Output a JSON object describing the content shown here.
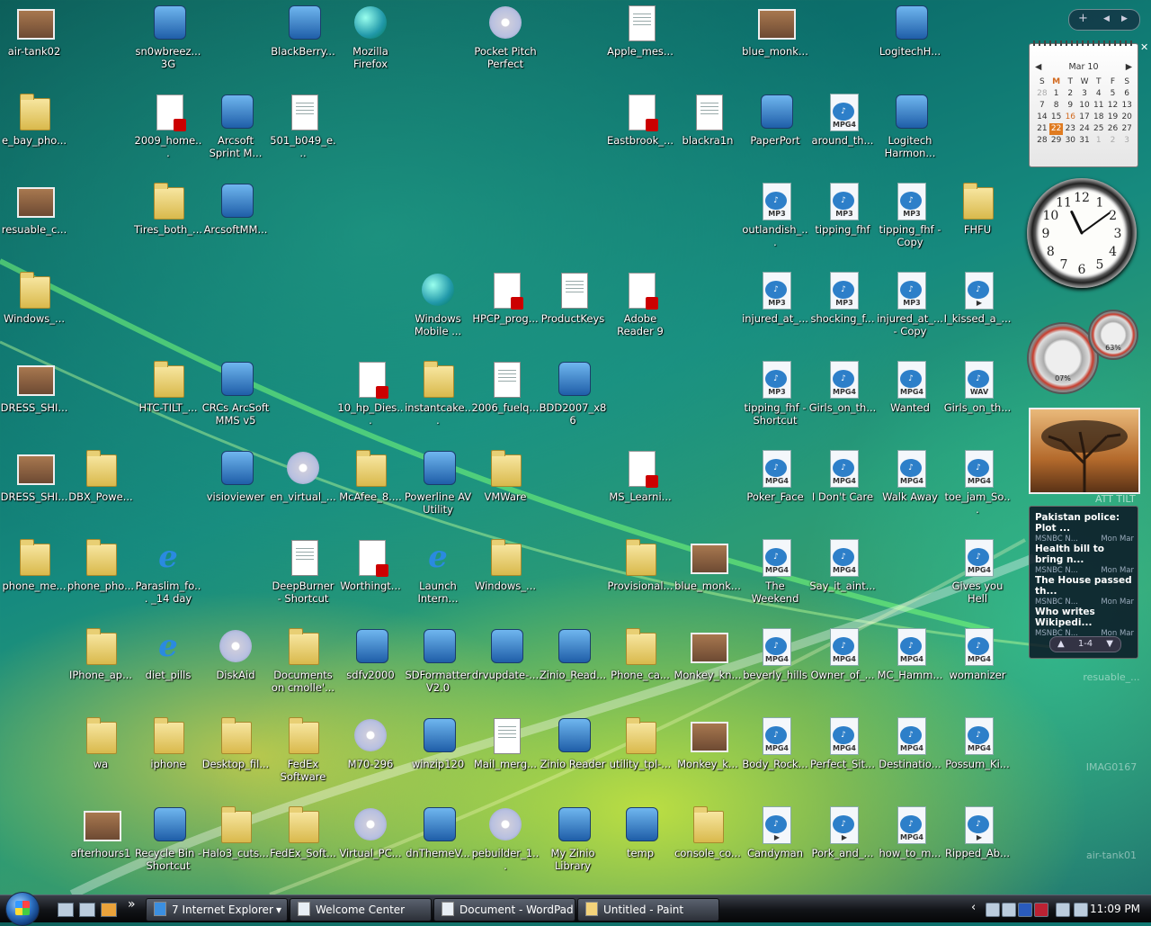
{
  "desktop_icons": [
    {
      "label": "air-tank02",
      "type": "photo",
      "col": 0,
      "row": 0
    },
    {
      "label": "sn0wbreez... 3G",
      "type": "app",
      "col": 1,
      "row": 0
    },
    {
      "label": "BlackBerry...",
      "type": "app",
      "col": 2,
      "row": 0
    },
    {
      "label": "Mozilla Firefox",
      "type": "globe",
      "col": 3,
      "row": 0
    },
    {
      "label": "Pocket Pitch Perfect",
      "type": "disc",
      "col": 4,
      "row": 0
    },
    {
      "label": "Apple_mes...",
      "type": "doc",
      "col": 5,
      "row": 0
    },
    {
      "label": "blue_monk...",
      "type": "photo",
      "col": 6,
      "row": 0
    },
    {
      "label": "LogitechH...",
      "type": "app",
      "col": 7,
      "row": 0
    },
    {
      "label": "e_bay_pho...",
      "type": "folder",
      "col": 0,
      "row": 1
    },
    {
      "label": "2009_home...",
      "type": "pdf",
      "col": 1,
      "row": 1
    },
    {
      "label": "Arcsoft Sprint M...",
      "type": "app",
      "col": 2,
      "row": 1
    },
    {
      "label": "501_b049_e...",
      "type": "doc",
      "col": 3,
      "row": 1
    },
    {
      "label": "Eastbrook_...",
      "type": "pdf",
      "col": 5,
      "row": 1
    },
    {
      "label": "blackra1n",
      "type": "doc",
      "col": 6,
      "row": 1
    },
    {
      "label": "PaperPort",
      "type": "app",
      "col": 7,
      "row": 1
    },
    {
      "label": "around_th...",
      "type": "media",
      "badge": "MPG4",
      "col": 8,
      "row": 1
    },
    {
      "label": "Logitech Harmon...",
      "type": "app",
      "col": 9,
      "row": 1
    },
    {
      "label": "resuable_c...",
      "type": "photo",
      "col": 0,
      "row": 2
    },
    {
      "label": "Tires_both_...",
      "type": "folder",
      "col": 1,
      "row": 2
    },
    {
      "label": "ArcsoftMM...",
      "type": "app",
      "col": 2,
      "row": 2
    },
    {
      "label": "outlandish_...",
      "type": "media",
      "badge": "MP3",
      "col": 7,
      "row": 2
    },
    {
      "label": "tipping_fhf",
      "type": "media",
      "badge": "MP3",
      "col": 8,
      "row": 2
    },
    {
      "label": "tipping_fhf - Copy",
      "type": "media",
      "badge": "MP3",
      "col": 9,
      "row": 2
    },
    {
      "label": "FHFU",
      "type": "folder",
      "col": 10,
      "row": 2
    },
    {
      "label": "Windows_...",
      "type": "folder",
      "col": 0,
      "row": 3
    },
    {
      "label": "Windows Mobile ...",
      "type": "globe",
      "col": 4,
      "row": 3
    },
    {
      "label": "HPCP_prog...",
      "type": "pdf",
      "col": 5,
      "row": 3
    },
    {
      "label": "ProductKeys",
      "type": "doc",
      "col": 6,
      "row": 3
    },
    {
      "label": "Adobe Reader 9",
      "type": "pdf",
      "col": 7,
      "row": 3
    },
    {
      "label": "injured_at_...",
      "type": "media",
      "badge": "MP3",
      "col": 8,
      "row": 3
    },
    {
      "label": "shocking_f...",
      "type": "media",
      "badge": "MP3",
      "col": 9,
      "row": 3
    },
    {
      "label": "injured_at_... - Copy",
      "type": "media",
      "badge": "MP3",
      "col": 10,
      "row": 3
    },
    {
      "label": "I_kissed_a_...",
      "type": "media",
      "badge": "▶",
      "col": 11,
      "row": 3
    },
    {
      "label": "DRESS_SHI...",
      "type": "photo",
      "col": 0,
      "row": 4
    },
    {
      "label": "HTC-TILT_...",
      "type": "folder",
      "col": 2,
      "row": 4
    },
    {
      "label": "CRCs ArcSoft MMS v5",
      "type": "app",
      "col": 3,
      "row": 4
    },
    {
      "label": "10_hp_Dies...",
      "type": "pdf",
      "col": 5,
      "row": 4
    },
    {
      "label": "instantcake...",
      "type": "folder",
      "col": 6,
      "row": 4
    },
    {
      "label": "2006_fuelq...",
      "type": "doc",
      "col": 7,
      "row": 4
    },
    {
      "label": "BDD2007_x86",
      "type": "app",
      "col": 8,
      "row": 4
    },
    {
      "label": "tipping_fhf - Shortcut",
      "type": "media",
      "badge": "MP3",
      "col": 9,
      "row": 4
    },
    {
      "label": "Girls_on_th...",
      "type": "media",
      "badge": "MPG4",
      "col": 10,
      "row": 4
    },
    {
      "label": "Wanted",
      "type": "media",
      "badge": "MPG4",
      "col": 11,
      "row": 4
    },
    {
      "label": "Girls_on_th...",
      "type": "media",
      "badge": "WAV",
      "col": 12,
      "row": 4
    },
    {
      "label": "DRESS_SHI...",
      "type": "photo",
      "col": 0,
      "row": 5
    },
    {
      "label": "DBX_Powe...",
      "type": "folder",
      "col": 1,
      "row": 5
    },
    {
      "label": "visioviewer",
      "type": "app",
      "col": 3,
      "row": 5
    },
    {
      "label": "en_virtual_...",
      "type": "disc",
      "col": 4,
      "row": 5
    },
    {
      "label": "McAfee_8....",
      "type": "folder",
      "col": 5,
      "row": 5
    },
    {
      "label": "Powerline AV Utility",
      "type": "app",
      "col": 6,
      "row": 5
    },
    {
      "label": "VMWare",
      "type": "folder",
      "col": 7,
      "row": 5
    },
    {
      "label": "MS_Learni...",
      "type": "pdf",
      "col": 9,
      "row": 5
    },
    {
      "label": "Poker_Face",
      "type": "media",
      "badge": "MPG4",
      "col": 11,
      "row": 5
    },
    {
      "label": "I Don't Care",
      "type": "media",
      "badge": "MPG4",
      "col": 12,
      "row": 5
    },
    {
      "label": "Walk Away",
      "type": "media",
      "badge": "MPG4",
      "col": 13,
      "row": 5
    },
    {
      "label": "toe_jam_So...",
      "type": "media",
      "badge": "MPG4",
      "col": 14,
      "row": 5
    },
    {
      "label": "phone_me...",
      "type": "folder",
      "col": 0,
      "row": 6
    },
    {
      "label": "phone_pho...",
      "type": "folder",
      "col": 1,
      "row": 6
    },
    {
      "label": "Paraslim_fo... _14 day",
      "type": "ie",
      "col": 2,
      "row": 6
    },
    {
      "label": "DeepBurner - Shortcut",
      "type": "doc",
      "col": 4,
      "row": 6
    },
    {
      "label": "Worthingt...",
      "type": "pdf",
      "col": 5,
      "row": 6
    },
    {
      "label": "Launch Intern...",
      "type": "ie",
      "col": 6,
      "row": 6
    },
    {
      "label": "Windows_...",
      "type": "folder",
      "col": 7,
      "row": 6
    },
    {
      "label": "Provisional...",
      "type": "folder",
      "col": 9,
      "row": 6
    },
    {
      "label": "blue_monk...",
      "type": "photo",
      "col": 10,
      "row": 6
    },
    {
      "label": "The Weekend",
      "type": "media",
      "badge": "MPG4",
      "col": 11,
      "row": 6
    },
    {
      "label": "Say_it_aint...",
      "type": "media",
      "badge": "MPG4",
      "col": 12,
      "row": 6
    },
    {
      "label": "Gives you Hell",
      "type": "media",
      "badge": "MPG4",
      "col": 14,
      "row": 6
    },
    {
      "label": "IPhone_ap...",
      "type": "folder",
      "col": 1,
      "row": 7
    },
    {
      "label": "diet_pills",
      "type": "ie",
      "col": 2,
      "row": 7
    },
    {
      "label": "DiskAid",
      "type": "disc",
      "col": 3,
      "row": 7
    },
    {
      "label": "Documents on cmolle'...",
      "type": "folder",
      "col": 4,
      "row": 7
    },
    {
      "label": "sdfv2000",
      "type": "app",
      "col": 5,
      "row": 7
    },
    {
      "label": "SDFormatter V2.0",
      "type": "app",
      "col": 6,
      "row": 7
    },
    {
      "label": "drvupdate-...",
      "type": "app",
      "col": 7,
      "row": 7
    },
    {
      "label": "Zinio_Read...",
      "type": "app",
      "col": 8,
      "row": 7
    },
    {
      "label": "Phone_ca...",
      "type": "folder",
      "col": 9,
      "row": 7
    },
    {
      "label": "Monkey_kn...",
      "type": "photo",
      "col": 10,
      "row": 7
    },
    {
      "label": "beverly_hills",
      "type": "media",
      "badge": "MPG4",
      "col": 11,
      "row": 7
    },
    {
      "label": "Owner_of_...",
      "type": "media",
      "badge": "MPG4",
      "col": 12,
      "row": 7
    },
    {
      "label": "MC_Hamm...",
      "type": "media",
      "badge": "MPG4",
      "col": 13,
      "row": 7
    },
    {
      "label": "womanizer",
      "type": "media",
      "badge": "MPG4",
      "col": 14,
      "row": 7
    },
    {
      "label": "wa",
      "type": "folder",
      "col": 1,
      "row": 8
    },
    {
      "label": "iphone",
      "type": "folder",
      "col": 2,
      "row": 8
    },
    {
      "label": "Desktop_fil...",
      "type": "folder",
      "col": 3,
      "row": 8
    },
    {
      "label": "FedEx Software",
      "type": "folder",
      "col": 4,
      "row": 8
    },
    {
      "label": "M70-296",
      "type": "disc",
      "col": 5,
      "row": 8
    },
    {
      "label": "winzip120",
      "type": "app",
      "col": 6,
      "row": 8
    },
    {
      "label": "Mail_merg...",
      "type": "doc",
      "col": 7,
      "row": 8
    },
    {
      "label": "Zinio Reader",
      "type": "app",
      "col": 8,
      "row": 8
    },
    {
      "label": "utility_tpl-...",
      "type": "folder",
      "col": 9,
      "row": 8
    },
    {
      "label": "Monkey_k...",
      "type": "photo",
      "col": 10,
      "row": 8
    },
    {
      "label": "Body_Rock...",
      "type": "media",
      "badge": "MPG4",
      "col": 11,
      "row": 8
    },
    {
      "label": "Perfect_Sit...",
      "type": "media",
      "badge": "MPG4",
      "col": 12,
      "row": 8
    },
    {
      "label": "Destinatio...",
      "type": "media",
      "badge": "MPG4",
      "col": 13,
      "row": 8
    },
    {
      "label": "Possum_Ki...",
      "type": "media",
      "badge": "MPG4",
      "col": 14,
      "row": 8
    },
    {
      "label": "afterhours1",
      "type": "photo",
      "col": 1,
      "row": 9
    },
    {
      "label": "Recycle Bin - Shortcut",
      "type": "app",
      "col": 2,
      "row": 9
    },
    {
      "label": "Halo3_cuts...",
      "type": "folder",
      "col": 3,
      "row": 9
    },
    {
      "label": "FedEx_Soft...",
      "type": "folder",
      "col": 4,
      "row": 9
    },
    {
      "label": "Virtual_PC...",
      "type": "disc",
      "col": 5,
      "row": 9
    },
    {
      "label": "dnThemeV...",
      "type": "app",
      "col": 6,
      "row": 9
    },
    {
      "label": "pebuilder_1...",
      "type": "disc",
      "col": 7,
      "row": 9
    },
    {
      "label": "My Zinio Library",
      "type": "app",
      "col": 8,
      "row": 9
    },
    {
      "label": "temp",
      "type": "app",
      "col": 9,
      "row": 9
    },
    {
      "label": "console_co...",
      "type": "folder",
      "col": 10,
      "row": 9
    },
    {
      "label": "Candyman",
      "type": "media",
      "badge": "▶",
      "col": 11,
      "row": 9
    },
    {
      "label": "Pork_and_...",
      "type": "media",
      "badge": "▶",
      "col": 12,
      "row": 9
    },
    {
      "label": "how_to_m...",
      "type": "media",
      "badge": "MPG4",
      "col": 13,
      "row": 9
    },
    {
      "label": "Ripped_Ab...",
      "type": "media",
      "badge": "▶",
      "col": 14,
      "row": 9
    }
  ],
  "ghost_icons": [
    {
      "label": "resuable_..."
    },
    {
      "label": "IMAG0167"
    },
    {
      "label": "air-tank01"
    }
  ],
  "sidebar": {
    "add_gadget": "+",
    "nav_prev": "◀",
    "nav_next": "▶",
    "close": "✕",
    "calendar": {
      "month": "Mar 10",
      "weekdays": [
        "S",
        "M",
        "T",
        "W",
        "T",
        "F",
        "S"
      ],
      "weeks": [
        [
          "28",
          "1",
          "2",
          "3",
          "4",
          "5",
          "6"
        ],
        [
          "7",
          "8",
          "9",
          "10",
          "11",
          "12",
          "13"
        ],
        [
          "14",
          "15",
          "16",
          "17",
          "18",
          "19",
          "20"
        ],
        [
          "21",
          "22",
          "23",
          "24",
          "25",
          "26",
          "27"
        ],
        [
          "28",
          "29",
          "30",
          "31",
          "1",
          "2",
          "3"
        ]
      ],
      "today": "22"
    },
    "clock": {
      "numbers": [
        "12",
        "1",
        "2",
        "3",
        "4",
        "5",
        "6",
        "7",
        "8",
        "9",
        "10",
        "11"
      ],
      "hour": 11,
      "minute": 9
    },
    "meter": {
      "cpu": "07%",
      "memory": "63%"
    },
    "slideshow_label": "ATT TILT",
    "feeds": [
      {
        "title": "Pakistan police: Plot ...",
        "source": "MSNBC N...",
        "date": "Mon Mar"
      },
      {
        "title": "Health bill to bring n...",
        "source": "MSNBC N...",
        "date": "Mon Mar"
      },
      {
        "title": "The House passed th...",
        "source": "MSNBC N...",
        "date": "Mon Mar"
      },
      {
        "title": "Who writes Wikipedi...",
        "source": "MSNBC N...",
        "date": "Mon Mar"
      }
    ],
    "feed_pager": "1-4",
    "feed_up": "▲",
    "feed_down": "▼"
  },
  "taskbar": {
    "buttons": [
      {
        "label": "7 Internet Explorer",
        "dropdown": "▾"
      },
      {
        "label": "Welcome Center"
      },
      {
        "label": "Document - WordPad"
      },
      {
        "label": "Untitled - Paint"
      }
    ],
    "overflow": "»",
    "tray_expand": "‹",
    "time": "11:09 PM"
  }
}
